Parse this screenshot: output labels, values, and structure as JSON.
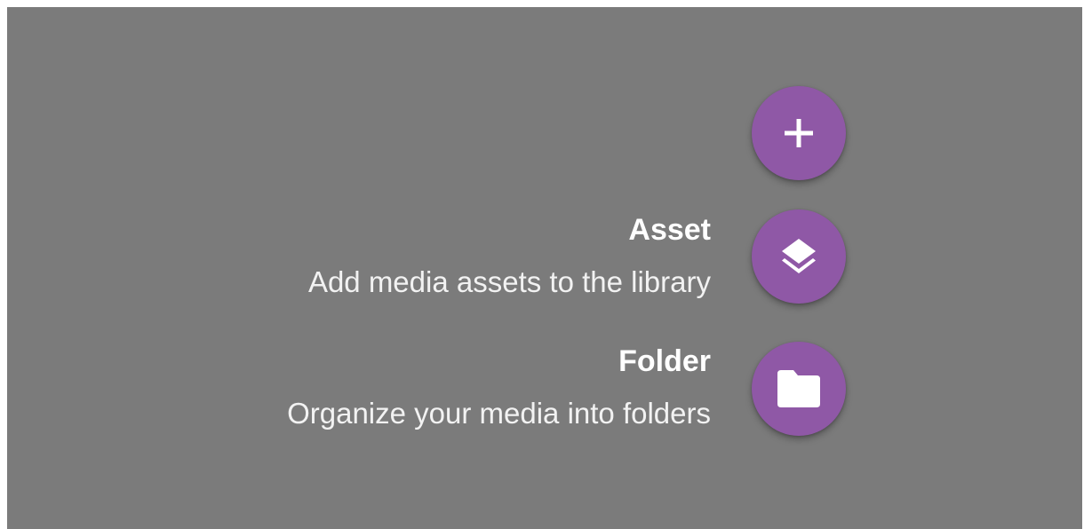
{
  "colors": {
    "overlay": "#7b7b7b",
    "fab": "#8f58a6",
    "text": "#ffffff"
  },
  "fab_menu": {
    "main_button": {
      "icon": "plus-icon"
    },
    "actions": [
      {
        "title": "Asset",
        "description": "Add media assets to the library",
        "icon": "layers-icon"
      },
      {
        "title": "Folder",
        "description": "Organize your media into folders",
        "icon": "folder-icon"
      }
    ]
  }
}
